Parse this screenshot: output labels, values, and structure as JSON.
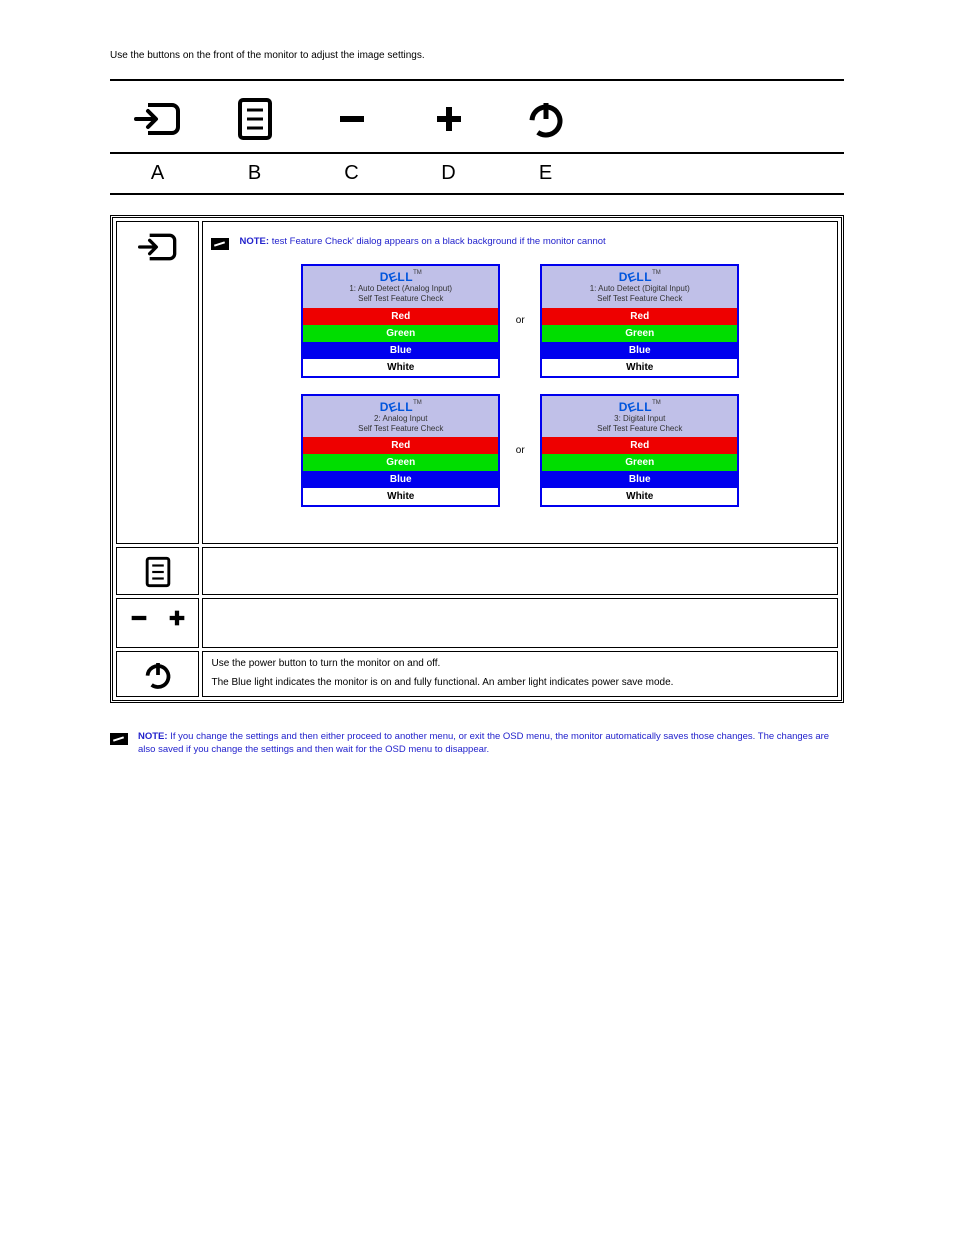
{
  "intro": "Use the buttons on the front of the monitor to adjust the image settings.",
  "labels": {
    "a": "A",
    "b": "B",
    "c": "C",
    "d": "D",
    "e": "E"
  },
  "note1_prefix": "NOTE:",
  "note1_body": "test Feature Check' dialog appears on a black background if the monitor cannot",
  "or": "or",
  "dlg1": {
    "line1": "1: Auto Detect (Analog Input)",
    "line2": "Self Test  Feature Check"
  },
  "dlg2": {
    "line1": "1: Auto Detect (Digital Input)",
    "line2": "Self Test  Feature Check"
  },
  "dlg3": {
    "line1": "2: Analog Input",
    "line2": "Self Test  Feature Check"
  },
  "dlg4": {
    "line1": "3: Digital Input",
    "line2": "Self Test  Feature Check"
  },
  "bars": {
    "red": "Red",
    "green": "Green",
    "blue": "Blue",
    "white": "White"
  },
  "dell_tm": "TM",
  "rowB_link": "",
  "rowD_line1": "Use the power button to turn the monitor on and off.",
  "rowD_line2": "The Blue light indicates the monitor is on and fully functional. An amber light indicates power save mode.",
  "osd_note_prefix": "NOTE:",
  "osd_note_body": "If you change the settings and then either proceed to another menu, or exit the OSD menu, the monitor automatically saves those changes. The changes are also saved if you change the settings and then wait for the OSD menu to disappear."
}
